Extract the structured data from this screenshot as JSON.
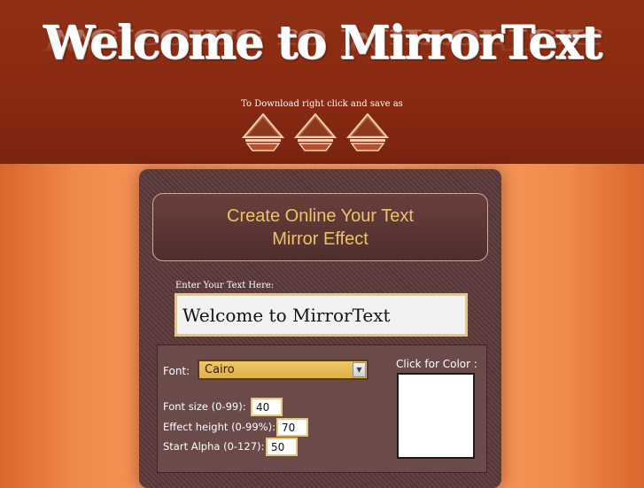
{
  "header": {
    "logo_text": "Welcome to MirrorText",
    "download_note": "To Download right click and save as",
    "download_buttons": [
      "download-arrow-icon",
      "download-arrow-icon",
      "download-arrow-icon"
    ]
  },
  "banner": {
    "line1": "Create Online Your Text",
    "line2": "Mirror Effect"
  },
  "form": {
    "enter_label": "Enter Your Text Here:",
    "text_value": "Welcome to MirrorText",
    "font_label": "Font:",
    "font_value": "Cairo",
    "font_size_label": "Font size (0-99):",
    "font_size_value": "40",
    "effect_height_label": "Effect height (0-99%):",
    "effect_height_value": "70",
    "start_alpha_label": "Start Alpha (0-127):",
    "start_alpha_value": "50",
    "color_label": "Click for Color :",
    "color_value": "#ffffff"
  },
  "colors": {
    "header_bg": "#8a2a12",
    "panel_bg": "#5a3838",
    "accent_gold": "#ecc26a",
    "input_border": "#e6c77a"
  }
}
